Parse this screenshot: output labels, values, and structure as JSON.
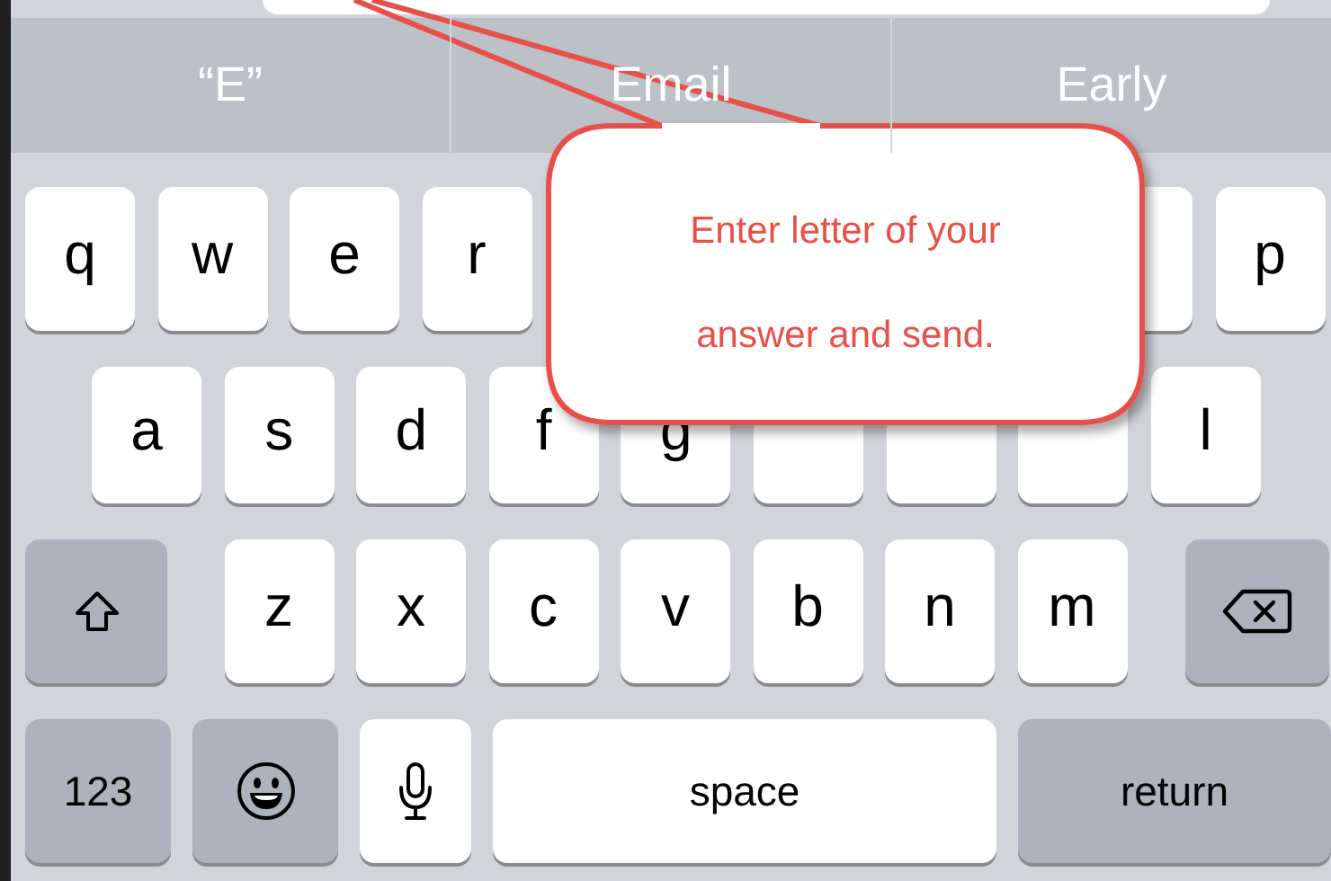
{
  "suggestions": [
    {
      "text": "“E”"
    },
    {
      "text": "Email"
    },
    {
      "text": "Early"
    }
  ],
  "keyboard": {
    "rows": [
      {
        "keys": [
          {
            "kind": "letter",
            "label": "q"
          },
          {
            "kind": "letter",
            "label": "w"
          },
          {
            "kind": "letter",
            "label": "e"
          },
          {
            "kind": "letter",
            "label": "r"
          },
          {
            "kind": "gap"
          },
          {
            "kind": "gap"
          },
          {
            "kind": "gap"
          },
          {
            "kind": "gap"
          },
          {
            "kind": "covered"
          },
          {
            "kind": "letter",
            "label": "p"
          }
        ]
      },
      {
        "keys": [
          {
            "kind": "letter",
            "label": "a"
          },
          {
            "kind": "letter",
            "label": "s"
          },
          {
            "kind": "letter",
            "label": "d"
          },
          {
            "kind": "letter",
            "label": "f"
          },
          {
            "kind": "letter",
            "label": "g"
          },
          {
            "kind": "covered"
          },
          {
            "kind": "covered"
          },
          {
            "kind": "covered"
          },
          {
            "kind": "letter",
            "label": "l"
          }
        ]
      },
      {
        "keys": [
          {
            "kind": "shift"
          },
          {
            "kind": "letter",
            "label": "z"
          },
          {
            "kind": "letter",
            "label": "x"
          },
          {
            "kind": "letter",
            "label": "c"
          },
          {
            "kind": "letter",
            "label": "v"
          },
          {
            "kind": "letter",
            "label": "b"
          },
          {
            "kind": "letter",
            "label": "n"
          },
          {
            "kind": "letter",
            "label": "m"
          },
          {
            "kind": "delete"
          }
        ]
      },
      {
        "keys": [
          {
            "kind": "numbers",
            "label": "123"
          },
          {
            "kind": "emoji"
          },
          {
            "kind": "dictation"
          },
          {
            "kind": "space",
            "label": "space"
          },
          {
            "kind": "return",
            "label": "return"
          }
        ]
      }
    ]
  },
  "callout": {
    "text": "Enter letter of your answer and send."
  }
}
